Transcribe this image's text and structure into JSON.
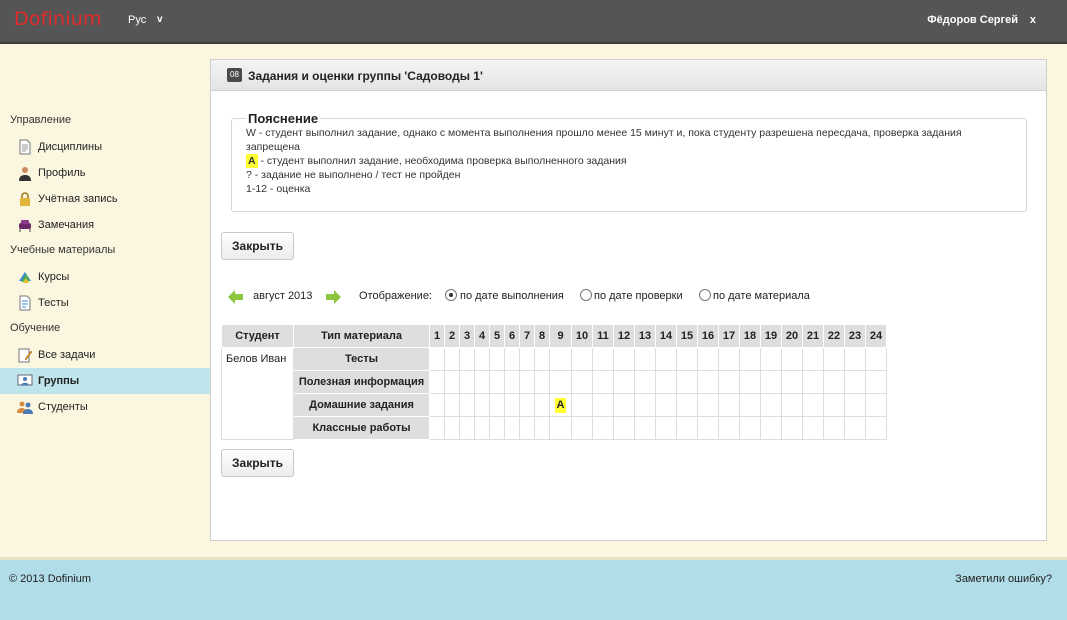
{
  "header": {
    "logo": "Dofinium",
    "language": "Рус",
    "language_arrow": "v",
    "user": "Фёдоров Сергей",
    "logout": "x"
  },
  "sidebar": {
    "sections": [
      {
        "title": "Управление",
        "items": [
          {
            "label": "Дисциплины",
            "icon": "document-icon"
          },
          {
            "label": "Профиль",
            "icon": "person-icon"
          },
          {
            "label": "Учётная запись",
            "icon": "lock-icon"
          },
          {
            "label": "Замечания",
            "icon": "chair-icon"
          }
        ]
      },
      {
        "title": "Учебные материалы",
        "items": [
          {
            "label": "Курсы",
            "icon": "books-icon"
          },
          {
            "label": "Тесты",
            "icon": "test-icon"
          }
        ]
      },
      {
        "title": "Обучение",
        "items": [
          {
            "label": "Все задачи",
            "icon": "pencil-note-icon"
          },
          {
            "label": "Группы",
            "icon": "group-board-icon",
            "active": true
          },
          {
            "label": "Студенты",
            "icon": "students-icon"
          }
        ]
      }
    ]
  },
  "panel": {
    "icon_text": "08",
    "title": "Задания и оценки группы 'Садоводы 1'"
  },
  "legend": {
    "title": "Пояснение",
    "line1": "W - студент выполнил задание, однако с момента выполнения прошло менее 15 минут и, пока студенту разрешена пересдача, проверка задания запрещена",
    "line2_mark": "A",
    "line2_text": " - студент выполнил задание, необходима проверка выполненного задания",
    "line3": "? - задание не выполнено / тест не пройден",
    "line4": "1-12 - оценка"
  },
  "buttons": {
    "close": "Закрыть"
  },
  "nav": {
    "month": "август 2013",
    "display_label": "Отображение:",
    "radios": [
      {
        "label": "по дате выполнения",
        "checked": true
      },
      {
        "label": "по дате проверки",
        "checked": false
      },
      {
        "label": "по дате материала",
        "checked": false
      }
    ]
  },
  "table": {
    "headers": {
      "student": "Студент",
      "material_type": "Тип материала"
    },
    "days": [
      "1",
      "2",
      "3",
      "4",
      "5",
      "6",
      "7",
      "8",
      "9",
      "10",
      "11",
      "12",
      "13",
      "14",
      "15",
      "16",
      "17",
      "18",
      "19",
      "20",
      "21",
      "22",
      "23",
      "24"
    ],
    "student": "Белов Иван",
    "rows": [
      {
        "type": "Тесты",
        "cells": {}
      },
      {
        "type": "Полезная информация",
        "cells": {}
      },
      {
        "type": "Домашние задания",
        "cells": {
          "9": "A"
        }
      },
      {
        "type": "Классные работы",
        "cells": {}
      }
    ]
  },
  "footer": {
    "copyright": "© 2013 Dofinium",
    "report": "Заметили ошибку?"
  },
  "colors": {
    "header_bg": "#555555",
    "logo": "#e32a2a",
    "sidebar_bg": "#fbf6df",
    "active_item": "#bfe5ec",
    "footer_bg": "#b0dde8",
    "highlight": "#ffff33",
    "arrow": "#8cc63f"
  }
}
